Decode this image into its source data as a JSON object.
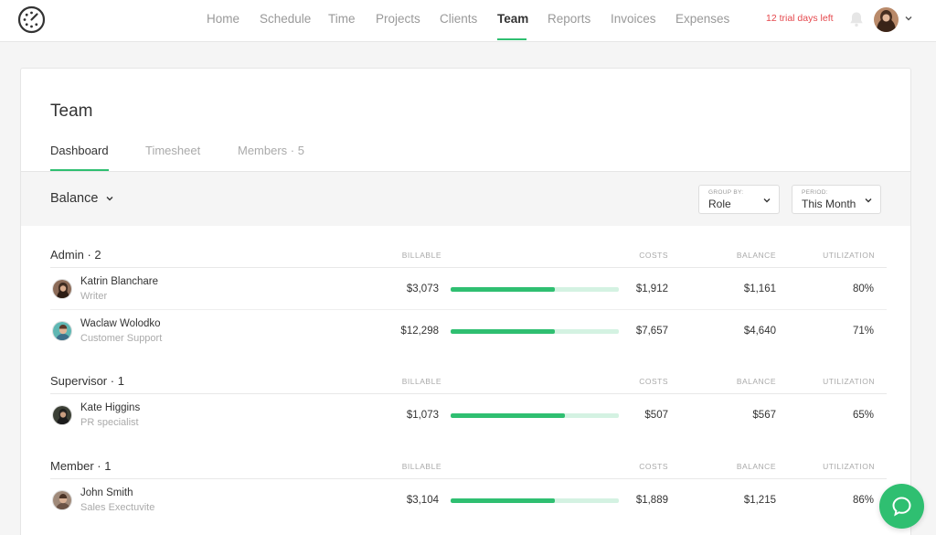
{
  "nav": {
    "items": [
      {
        "label": "Home",
        "active": false
      },
      {
        "label": "Schedule",
        "active": false
      },
      {
        "label": "Time",
        "active": false
      },
      {
        "label": "Projects",
        "active": false
      },
      {
        "label": "Clients",
        "active": false
      },
      {
        "label": "Team",
        "active": true
      },
      {
        "label": "Reports",
        "active": false
      },
      {
        "label": "Invoices",
        "active": false
      },
      {
        "label": "Expenses",
        "active": false
      }
    ],
    "trial_text": "12 trial days left",
    "logo_icon": "stopwatch-logo-icon",
    "bell_icon": "bell-icon"
  },
  "page": {
    "title": "Team",
    "tabs": [
      {
        "label": "Dashboard",
        "active": true
      },
      {
        "label": "Timesheet",
        "active": false
      },
      {
        "label": "Members · 5",
        "active": false
      }
    ]
  },
  "toolbar": {
    "view_label": "Balance",
    "group_by": {
      "label": "GROUP BY:",
      "value": "Role"
    },
    "period": {
      "label": "PERIOD:",
      "value": "This Month"
    }
  },
  "columns": {
    "billable": "BILLABLE",
    "costs": "COSTS",
    "balance": "BALANCE",
    "utilization": "UTILIZATION"
  },
  "groups": [
    {
      "title": "Admin · 2",
      "members": [
        {
          "name": "Katrin Blanchare",
          "role": "Writer",
          "billable": "$3,073",
          "bar_fraction": 0.62,
          "costs": "$1,912",
          "balance": "$1,161",
          "utilization": "80%"
        },
        {
          "name": "Waclaw Wolodko",
          "role": "Customer Support",
          "billable": "$12,298",
          "bar_fraction": 0.62,
          "costs": "$7,657",
          "balance": "$4,640",
          "utilization": "71%"
        }
      ]
    },
    {
      "title": "Supervisor · 1",
      "members": [
        {
          "name": "Kate Higgins",
          "role": "PR specialist",
          "billable": "$1,073",
          "bar_fraction": 0.68,
          "costs": "$507",
          "balance": "$567",
          "utilization": "65%"
        }
      ]
    },
    {
      "title": "Member · 1",
      "members": [
        {
          "name": "John Smith",
          "role": "Sales Exectuvite",
          "billable": "$3,104",
          "bar_fraction": 0.62,
          "costs": "$1,889",
          "balance": "$1,215",
          "utilization": "86%"
        }
      ]
    }
  ],
  "colors": {
    "accent": "#2fbf71",
    "accent_light": "#d4f2e2",
    "trial_red": "#e5484d"
  }
}
